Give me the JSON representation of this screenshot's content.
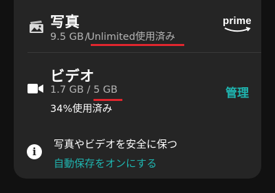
{
  "photos": {
    "title": "写真",
    "used": "9.5 GB",
    "separator": " / ",
    "capacity": "Unlimited使用済み",
    "icon": "photo-icon",
    "badge": "prime"
  },
  "videos": {
    "title": "ビデオ",
    "used": "1.7 GB",
    "separator": " / ",
    "capacity": "5 GB",
    "percent_used": "34%使用済み",
    "icon": "video-camera-icon",
    "manage_label": "管理"
  },
  "info": {
    "icon": "info-icon",
    "text": "写真やビデオを安全に保つ",
    "link": "自動保存をオンにする"
  },
  "colors": {
    "accent": "#1fb5b0",
    "highlight": "#e0262e",
    "card": "#252525",
    "background": "#111111"
  }
}
